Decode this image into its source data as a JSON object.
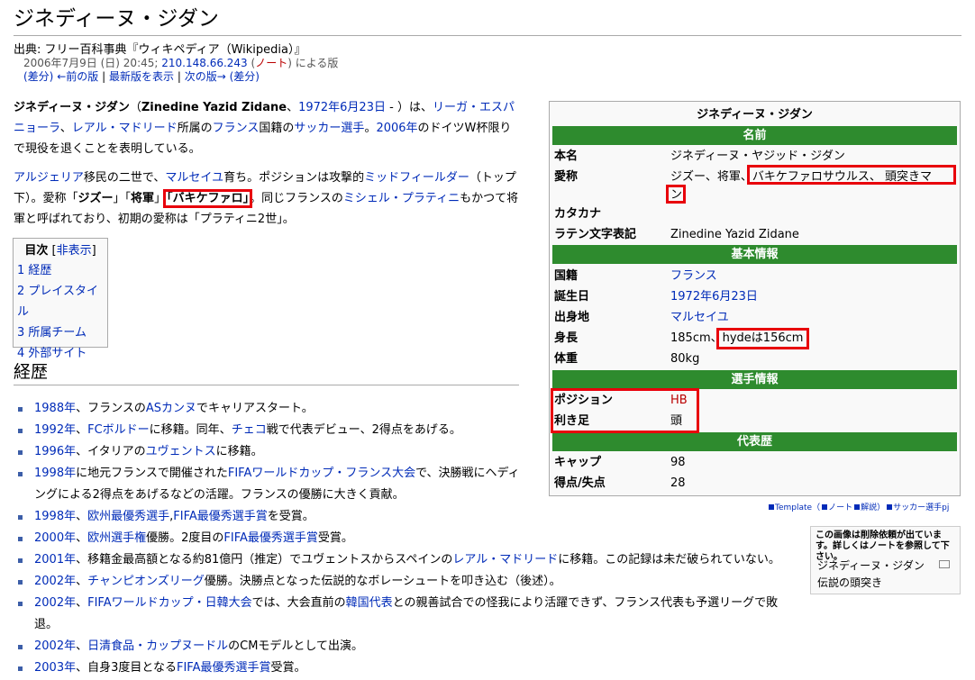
{
  "header": {
    "title": "ジネディーヌ・ジダン",
    "source": "出典: フリー百科事典『ウィキペディア（Wikipedia）』",
    "revision": {
      "date": "2006年7月9日 (日) 20:45;",
      "ip": "210.148.66.243",
      "note_open": "(",
      "note": "ノート",
      "note_close": ")",
      "by": "による版"
    },
    "nav": {
      "diff": "(差分)",
      "prev": "←前の版",
      "sep1": "|",
      "latest": "最新版を表示",
      "sep2": "|",
      "next": "次の版→",
      "diff2": "(差分)"
    }
  },
  "lead": {
    "p1_name": "ジネディーヌ・ジダン",
    "p1_a": "（",
    "p1_latin": "Zinedine Yazid Zidane",
    "p1_b": "、",
    "p1_date": "1972年6月23日",
    "p1_c": " - ）は、",
    "p1_league": "リーガ・エスパニョーラ",
    "p1_d": "、",
    "p1_club": "レアル・マドリード",
    "p1_e": "所属の",
    "p1_country": "フランス",
    "p1_f": "国籍の",
    "p1_player": "サッカー選手",
    "p1_g": "。",
    "p1_year": "2006年",
    "p1_h": "のドイツW杯限りで現役を退くことを表明している。",
    "p2_algeria": "アルジェリア",
    "p2_a": "移民の二世で、",
    "p2_marseille": "マルセイユ",
    "p2_b": "育ち。ポジションは攻撃的",
    "p2_mf": "ミッドフィールダー",
    "p2_c": "（トップ下）。愛称「",
    "p2_nick1": "ジズー",
    "p2_d": "」「",
    "p2_nick2": "将軍",
    "p2_e": "」",
    "p2_nick3": "「バキケファロ」",
    "p2_f": "。同じフランスの",
    "p2_platini": "ミシェル・プラティニ",
    "p2_g": "もかつて将軍と呼ばれており、初期の愛称は「プラティニ2世」。"
  },
  "toc": {
    "title": "目次",
    "toggle_open": "[",
    "toggle": "非表示",
    "toggle_close": "]",
    "items": [
      "1 経歴",
      "2 プレイスタイル",
      "3 所属チーム",
      "4 外部サイト"
    ]
  },
  "section": {
    "history": "経歴"
  },
  "history": [
    {
      "y": "1988年",
      "a": "、フランスの",
      "l": "ASカンヌ",
      "b": "でキャリアスタート。"
    },
    {
      "y": "1992年",
      "a": "、",
      "l": "FCボルドー",
      "b": "に移籍。同年、",
      "l2": "チェコ",
      "c": "戦で代表デビュー、2得点をあげる。"
    },
    {
      "y": "1996年",
      "a": "、イタリアの",
      "l": "ユヴェントス",
      "b": "に移籍。"
    },
    {
      "y": "1998年",
      "a": "に地元フランスで開催された",
      "l": "FIFAワールドカップ・フランス大会",
      "b": "で、決勝戦にヘディングによる2得点をあげるなどの活躍。フランスの優勝に大きく貢献。"
    },
    {
      "y": "1998年",
      "a": "、",
      "l": "欧州最優秀選手",
      "b": ",",
      "l2": "FIFA最優秀選手賞",
      "c": "を受賞。"
    },
    {
      "y": "2000年",
      "a": "、",
      "l": "欧州選手権",
      "b": "優勝。2度目の",
      "l2": "FIFA最優秀選手賞",
      "c": "受賞。"
    },
    {
      "y": "2001年",
      "a": "、移籍金最高額となる約81億円（推定）でユヴェントスからスペインの",
      "l": "レアル・マドリード",
      "b": "に移籍。この記録は未だ破られていない。"
    },
    {
      "y": "2002年",
      "a": "、",
      "l": "チャンピオンズリーグ",
      "b": "優勝。決勝点となった伝説的なボレーシュートを叩き込む（後述）。"
    },
    {
      "y": "2002年",
      "a": "、",
      "l": "FIFAワールドカップ・日韓大会",
      "b": "では、大会直前の",
      "l2": "韓国代表",
      "c": "との親善試合での怪我により活躍できず、フランス代表も予選リーグで敗退。"
    },
    {
      "y": "2002年",
      "a": "、",
      "l": "日清食品・カップヌードル",
      "b": "のCMモデルとして出演。"
    },
    {
      "y": "2003年",
      "a": "、自身3度目となる",
      "l": "FIFA最優秀選手賞",
      "b": "受賞。"
    }
  ],
  "infobox": {
    "caption": "ジネディーヌ・ジダン",
    "sec_name": "名前",
    "name_k": "本名",
    "name_v": "ジネディーヌ・ヤジッド・ジダン",
    "nick_k": "愛称",
    "nick_v": "ジズー、将軍、",
    "nick_v2": "バキケファロサウルス、 頭突きマ",
    "nick_v3": "ン",
    "kana_k": "カタカナ",
    "latin_k": "ラテン文字表記",
    "latin_v": "Zinedine Yazid Zidane",
    "sec_basic": "基本情報",
    "nat_k": "国籍",
    "nat_v": "フランス",
    "birth_k": "誕生日",
    "birth_v": "1972年6月23日",
    "origin_k": "出身地",
    "origin_v": "マルセイユ",
    "height_k": "身長",
    "height_v": "185cm、",
    "height_v2": "hydeは156cm",
    "weight_k": "体重",
    "weight_v": "80kg",
    "sec_player": "選手情報",
    "pos_k": "ポジション",
    "pos_v": "HB",
    "foot_k": "利き足",
    "foot_v": "頭",
    "sec_national": "代表歴",
    "caps_k": "キャップ",
    "caps_v": "98",
    "goals_k": "得点/失点",
    "goals_v": "28"
  },
  "template_note": {
    "a": "Template（",
    "b": "ノート",
    "c": "解説）",
    "d": "サッカー選手pj"
  },
  "deletion": {
    "warning": "この画像は削除依頼が出ています。詳しくはノートを参照して下さい。",
    "cap1": "ジネディーヌ・ジダン",
    "cap2": "伝説の頭突き"
  }
}
